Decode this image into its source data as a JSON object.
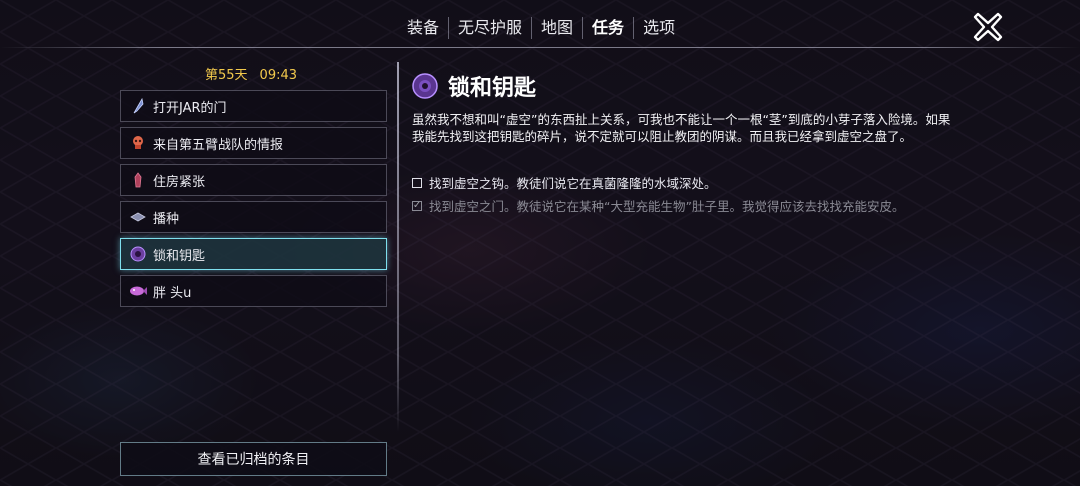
{
  "nav": {
    "tabs": [
      {
        "label": "装备"
      },
      {
        "label": "无尽护服"
      },
      {
        "label": "地图"
      },
      {
        "label": "任务"
      },
      {
        "label": "选项"
      }
    ],
    "active_tab": "任务",
    "close_icon": "close-x-icon"
  },
  "sidebar": {
    "day": "第55天",
    "time": "09:43",
    "quests": [
      {
        "label": "打开JAR的门",
        "icon": "feather-icon"
      },
      {
        "label": "来自第五臂战队的情报",
        "icon": "skull-icon"
      },
      {
        "label": "住房紧张",
        "icon": "crystal-icon"
      },
      {
        "label": "播种",
        "icon": "seed-icon"
      },
      {
        "label": "锁和钥匙",
        "icon": "void-orb-icon"
      },
      {
        "label": "胖 头u",
        "icon": "fish-icon"
      }
    ],
    "selected_quest": "锁和钥匙",
    "archive_button": "查看已归档的条目"
  },
  "detail": {
    "title": "锁和钥匙",
    "icon": "void-orb-icon",
    "description": "虽然我不想和叫“虚空”的东西扯上关系，可我也不能让一个一根“茎”到底的小芽子落入险境。如果我能先找到这把钥匙的碎片，说不定就可以阻止教团的阴谋。而且我已经拿到虚空之盘了。",
    "objectives": [
      {
        "text": "找到虚空之钩。教徒们说它在真菌隆隆的水域深处。",
        "done": false
      },
      {
        "text": "找到虚空之门。教徒说它在某种“大型充能生物”肚子里。我觉得应该去找找充能安皮。",
        "done": true
      }
    ]
  },
  "colors": {
    "accent_cyan": "#7fe0ee",
    "day_time_gold": "#f2c94c",
    "completed_gray": "#8a8a94"
  }
}
